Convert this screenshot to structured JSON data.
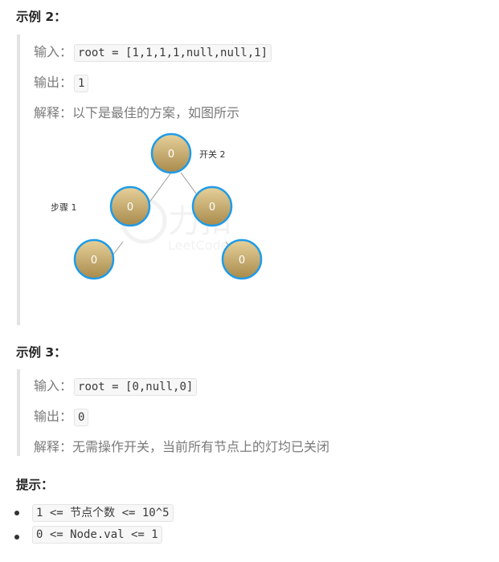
{
  "example2": {
    "heading": "示例 2：",
    "input_label": "输入：",
    "input_code": "root = [1,1,1,1,null,null,1]",
    "output_label": "输出：",
    "output_code": "1",
    "explain_label": "解释：",
    "explain_text": "以下是最佳的方案，如图所示",
    "tree": {
      "nodes": [
        {
          "id": "root",
          "value": "0",
          "label": "开关 2"
        },
        {
          "id": "left",
          "value": "0",
          "label": "步骤 1"
        },
        {
          "id": "right",
          "value": "0",
          "label": ""
        },
        {
          "id": "left-left",
          "value": "0",
          "label": ""
        },
        {
          "id": "right-right",
          "value": "0",
          "label": ""
        }
      ],
      "watermark": {
        "brand": "力扣",
        "sub": "LeetCode"
      }
    }
  },
  "example3": {
    "heading": "示例 3：",
    "input_label": "输入：",
    "input_code": "root = [0,null,0]",
    "output_label": "输出：",
    "output_code": "0",
    "explain_label": "解释：",
    "explain_text": "无需操作开关，当前所有节点上的灯均已关闭"
  },
  "hints": {
    "heading": "提示：",
    "items": [
      "1 <= 节点个数 <= 10^5",
      "0 <= Node.val <= 1"
    ]
  },
  "colors": {
    "node_fill_top": "#e6d19a",
    "node_fill_bottom": "#a88a4c",
    "node_ring": "#1e9be9",
    "edge": "#9a9a9a"
  }
}
